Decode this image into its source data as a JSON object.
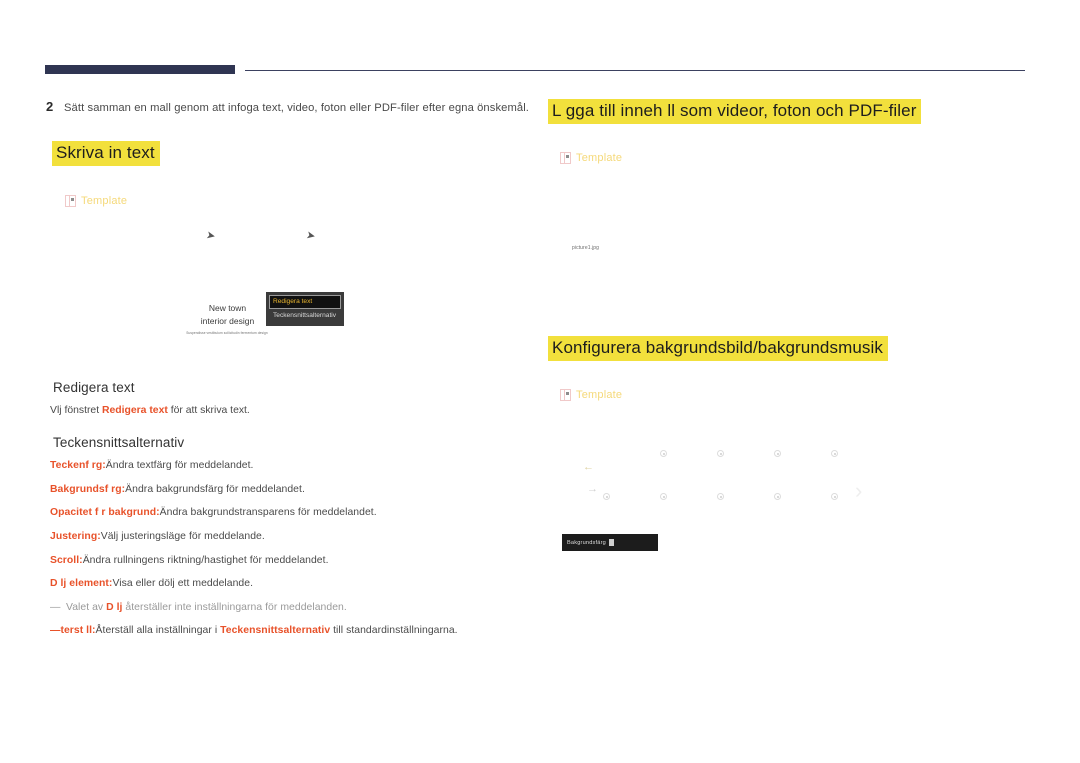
{
  "page": {
    "language": "sv"
  },
  "step": {
    "number": "2",
    "text": "Sätt samman en mall genom att infoga text, video, foton eller PDF-filer efter egna önskemål."
  },
  "headings": {
    "skriva_in_text": "Skriva in text",
    "lagga_till_innehall": "L gga till inneh ll som videor, foton och PDF-filer",
    "konfigurera": "Konfigurera bakgrundsbild/bakgrundsmusik"
  },
  "template_tags": {
    "label": "Template"
  },
  "preview_left": {
    "caption_line1": "New town",
    "caption_line2": "interior design",
    "fineprint": "Suspendisse vestibulum sollicitudin fermentum design",
    "context_menu": {
      "selected": "Redigera text",
      "second": "Teckensnittsalternativ"
    }
  },
  "preview_right": {
    "picture_label": "picture1.jpg",
    "background_bar_label": "Bakgrundsfärg"
  },
  "sections": {
    "redigera_text": {
      "title": "Redigera text",
      "lead_prefix": "V",
      "lead_before": "lj fönstret ",
      "lead_term": "Redigera text",
      "lead_after": " för att skriva text."
    },
    "teckensnittsalternativ": {
      "title": "Teckensnittsalternativ"
    }
  },
  "options": [
    {
      "term": "Teckenf rg:",
      "desc": "Ändra textfärg för meddelandet."
    },
    {
      "term": "Bakgrundsf rg:",
      "desc": "Ändra bakgrundsfärg för meddelandet."
    },
    {
      "term": "Opacitet f r bakgrund:",
      "desc": "Ändra bakgrundstransparens för meddelandet."
    },
    {
      "term": "Justering:",
      "desc": "Välj justeringsläge för meddelande."
    },
    {
      "term": "Scroll:",
      "desc": "Ändra rullningens riktning/hastighet för meddelandet."
    },
    {
      "term": "D lj element:",
      "desc": "Visa eller dölj ett meddelande."
    }
  ],
  "note": {
    "dash": "―",
    "before": "Valet av ",
    "term": "D lj",
    "after": " återställer inte inställningarna för meddelanden."
  },
  "reset_option": {
    "term": "―terst ll:",
    "before": "Återställ alla inställningar i ",
    "term_inline": "Teckensnittsalternativ",
    "after": " till standardinställningarna."
  },
  "colors": {
    "highlight": "#f2e03c",
    "accent_red": "#e8522a",
    "rule_navy": "#2f3552",
    "template_gold": "#f5d97a"
  }
}
